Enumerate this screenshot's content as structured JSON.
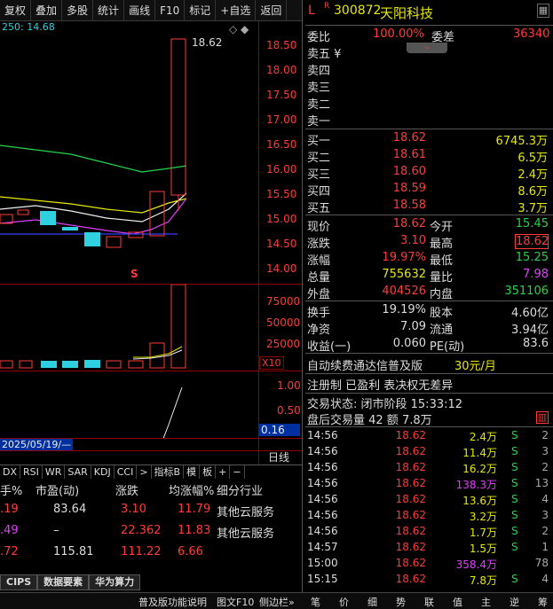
{
  "toolbar": [
    "复权",
    "叠加",
    "多股",
    "统计",
    "画线",
    "F10",
    "标记",
    "+自选",
    "返回"
  ],
  "chart": {
    "top_indicator": "250: 14.68",
    "high_label": "18.62",
    "price_ticks": [
      "18.50",
      "18.00",
      "17.50",
      "17.00",
      "16.50",
      "16.00",
      "15.50",
      "15.00",
      "14.50",
      "14.00"
    ],
    "vol_ticks": [
      "75000",
      "50000",
      "25000"
    ],
    "vol_unit": "X10",
    "ind_ticks": [
      "1.00",
      "0.50"
    ],
    "ind_value": "0.16",
    "date": "2025/05/19/—",
    "period": "日线",
    "s_mark": "S"
  },
  "subtabs": [
    "DX",
    "RSI",
    "WR",
    "SAR",
    "KDJ",
    "CCI",
    ">",
    "指标B",
    "模",
    "板",
    "+",
    "−"
  ],
  "table": {
    "headers": [
      "手%",
      "市盈(动)",
      "涨跌",
      "均涨幅%",
      "细分行业"
    ],
    "rows": [
      {
        "c1": ".19",
        "c2": "83.64",
        "c3": "3.10",
        "c4": "11.79",
        "c5": "其他云服务"
      },
      {
        "c1": ".49",
        "c2": "–",
        "c3": "22.362",
        "c4": "11.83",
        "c5": "其他云服务"
      },
      {
        "c1": ".72",
        "c2": "115.81",
        "c3": "111.22",
        "c4": "6.66",
        "c5": ""
      }
    ]
  },
  "bottom_tabs": [
    "CIPS",
    "数据要素",
    "华为算力"
  ],
  "status": {
    "help": "普及版功能说明",
    "f10": "图文F10",
    "side": "侧边栏»"
  },
  "quote": {
    "flag": "L",
    "r": "R",
    "code": "300872",
    "name": "天阳科技",
    "weibi_label": "委比",
    "weibi": "100.00%",
    "weicha_label": "委差",
    "weicha": "36340",
    "sells": [
      "卖五 ¥",
      "卖四",
      "卖三",
      "卖二",
      "卖一"
    ],
    "buys": [
      {
        "l": "买一",
        "p": "18.62",
        "v": "6745.3万"
      },
      {
        "l": "买二",
        "p": "18.61",
        "v": "6.5万"
      },
      {
        "l": "买三",
        "p": "18.60",
        "v": "2.4万"
      },
      {
        "l": "买四",
        "p": "18.59",
        "v": "8.6万"
      },
      {
        "l": "买五",
        "p": "18.58",
        "v": "3.7万"
      }
    ],
    "stats": [
      {
        "a": "现价",
        "b": "18.62",
        "c": "今开",
        "d": "15.45"
      },
      {
        "a": "涨跌",
        "b": "3.10",
        "c": "最高",
        "d": "18.62"
      },
      {
        "a": "涨幅",
        "b": "19.97%",
        "c": "最低",
        "d": "15.25"
      },
      {
        "a": "总量",
        "b": "755632",
        "c": "量比",
        "d": "7.98"
      },
      {
        "a": "外盘",
        "b": "404526",
        "c": "内盘",
        "d": "351106"
      }
    ],
    "stats2": [
      {
        "a": "换手",
        "b": "19.19%",
        "c": "股本",
        "d": "4.60亿"
      },
      {
        "a": "净资",
        "b": "7.09",
        "c": "流通",
        "d": "3.94亿"
      },
      {
        "a": "收益(一)",
        "b": "0.060",
        "c": "PE(动)",
        "d": "83.6"
      }
    ],
    "ad": "自动续费通达信普及版",
    "ad_price": "30元/月",
    "reg": "注册制 已盈利 表决权无差异",
    "state": "交易状态: 闭市阶段 15:33:12",
    "after": "盘后交易量 42 额 7.8万"
  },
  "ticks": [
    {
      "t": "14:56",
      "p": "18.62",
      "v": "2.4万",
      "s": "S",
      "n": "2"
    },
    {
      "t": "14:56",
      "p": "18.62",
      "v": "11.4万",
      "s": "S",
      "n": "3"
    },
    {
      "t": "14:56",
      "p": "18.62",
      "v": "16.2万",
      "s": "S",
      "n": "2"
    },
    {
      "t": "14:56",
      "p": "18.62",
      "v": "138.3万",
      "s": "S",
      "n": "13"
    },
    {
      "t": "14:56",
      "p": "18.62",
      "v": "13.6万",
      "s": "S",
      "n": "4"
    },
    {
      "t": "14:56",
      "p": "18.62",
      "v": "3.2万",
      "s": "S",
      "n": "3"
    },
    {
      "t": "14:56",
      "p": "18.62",
      "v": "1.7万",
      "s": "S",
      "n": "2"
    },
    {
      "t": "14:57",
      "p": "18.62",
      "v": "1.5万",
      "s": "S",
      "n": "1"
    },
    {
      "t": "15:00",
      "p": "18.62",
      "v": "358.4万",
      "s": "",
      "n": "78"
    },
    {
      "t": "15:15",
      "p": "18.62",
      "v": "7.8万",
      "s": "S",
      "n": "4"
    }
  ],
  "right_tabs": [
    "笔",
    "价",
    "细",
    "势",
    "联",
    "值",
    "主",
    "逆",
    "筹"
  ]
}
